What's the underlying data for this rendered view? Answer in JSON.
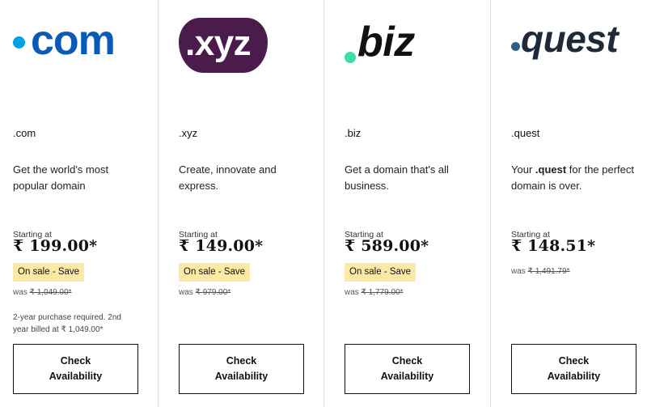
{
  "products": [
    {
      "logo": {
        "prefix": ".",
        "text": "com",
        "dot_color": "#00a4e4",
        "text_color": "#0a5bb5"
      },
      "tld": ".com",
      "description": "Get the world's most popular domain",
      "starting_at": "Starting at",
      "price": "₹ 199.00*",
      "badge": "On sale - Save",
      "was_label": "was",
      "was_price": "₹ 1,049.00*",
      "note": "2-year purchase required. 2nd year billed at ₹ 1,049.00*",
      "button_line1": "Check",
      "button_line2": "Availability"
    },
    {
      "logo": {
        "text": ".xyz",
        "bg_color": "#4a1c4b",
        "text_color": "#ffffff"
      },
      "tld": ".xyz",
      "description": "Create, innovate and express.",
      "starting_at": "Starting at",
      "price": "₹ 149.00*",
      "badge": "On sale - Save",
      "was_label": "was",
      "was_price": "₹ 979.00*",
      "button_line1": "Check",
      "button_line2": "Availability"
    },
    {
      "logo": {
        "text": "biz",
        "dot_color": "#3ddfa2",
        "text_color": "#111111"
      },
      "tld": ".biz",
      "description": "Get a domain that's all business.",
      "starting_at": "Starting at",
      "price": "₹ 589.00*",
      "badge": "On sale - Save",
      "was_label": "was",
      "was_price": "₹ 1,779.00*",
      "button_line1": "Check",
      "button_line2": "Availability"
    },
    {
      "logo": {
        "text": "quest",
        "dot_color": "#2b5f88",
        "text_color": "#1f2a38"
      },
      "tld": ".quest",
      "description_prefix": "Your ",
      "description_bold": ".quest",
      "description_suffix": " for the perfect domain is over.",
      "starting_at": "Starting at",
      "price": "₹ 148.51*",
      "was_label": "was",
      "was_price": "₹ 1,491.79*",
      "button_line1": "Check",
      "button_line2": "Availability"
    }
  ],
  "colors": {
    "badge_bg": "#fde9a6",
    "divider": "#e0e0e0"
  }
}
